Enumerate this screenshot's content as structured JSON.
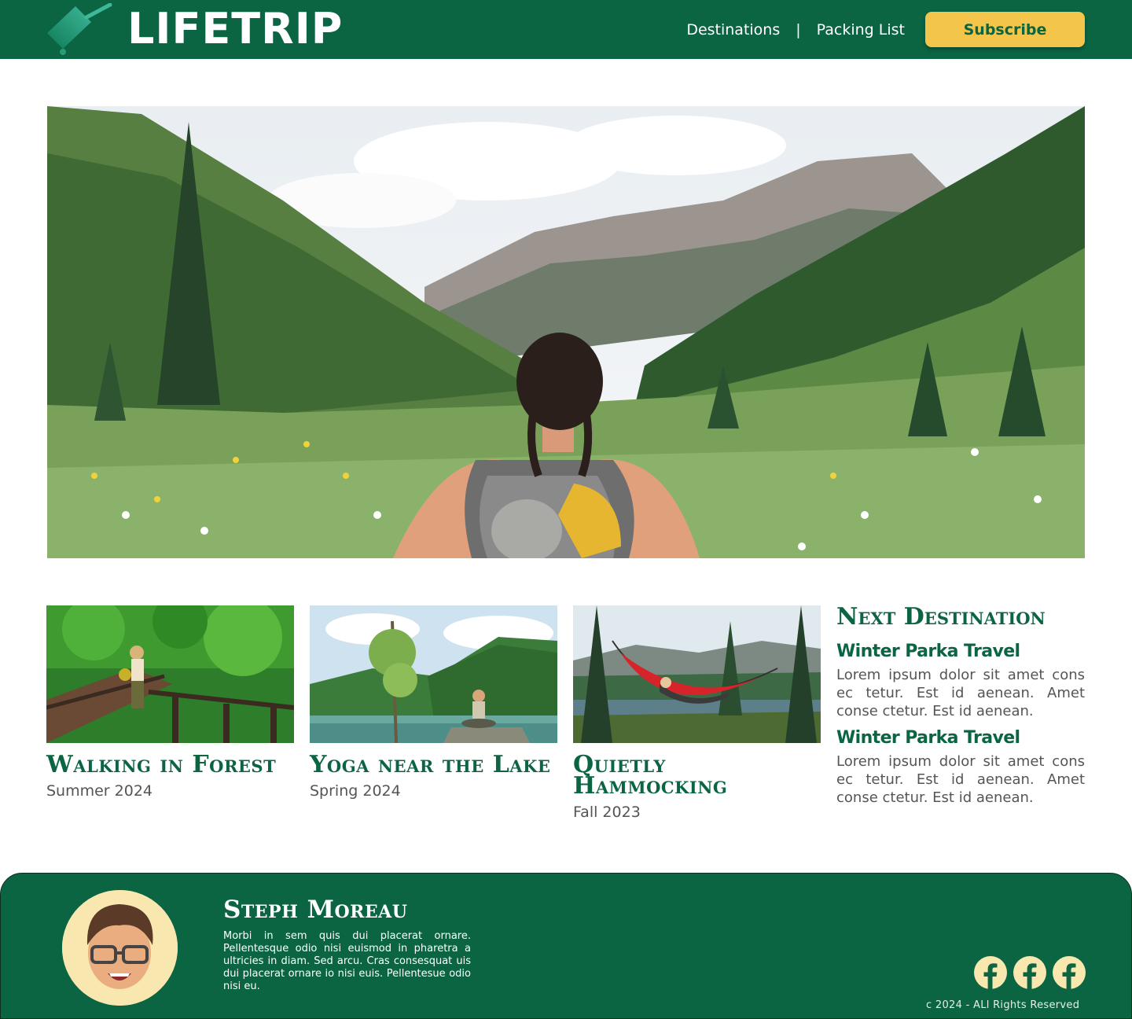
{
  "header": {
    "logo_text": "LIFETRIP",
    "logo_icon": "suitcase-icon",
    "nav": [
      {
        "label": "Destinations"
      },
      {
        "separator": "|"
      },
      {
        "label": "Packing List"
      }
    ],
    "subscribe_label": "Subscribe"
  },
  "hero": {
    "image": "hiker-in-mountain-valley"
  },
  "cards": [
    {
      "title": "Walking in Forest",
      "season": "Summer 2024",
      "image": "forest-boardwalk"
    },
    {
      "title": "Yoga near the Lake",
      "season": "Spring 2024",
      "image": "lake-yoga"
    },
    {
      "title": "Quietly Hammocking",
      "season": "Fall 2023",
      "image": "red-hammock"
    }
  ],
  "sidebar": {
    "title": "Next Destination",
    "items": [
      {
        "title": "Winter Parka Travel",
        "text": "Lorem ipsum dolor sit amet cons ec tetur. Est id aenean. Amet conse ctetur. Est id aenean."
      },
      {
        "title": "Winter Parka Travel",
        "text": "Lorem ipsum dolor sit amet cons ec tetur. Est id aenean. Amet conse ctetur. Est id aenean."
      }
    ]
  },
  "footer": {
    "avatar": "memoji-avatar",
    "name": "Steph Moreau",
    "bio": "Morbi in sem quis dui placerat ornare. Pellentesque odio nisi euismod in pharetra a ultricies in diam. Sed arcu. Cras consesquat uis dui placerat ornare io nisi euis. Pellentesue odio nisi eu.",
    "socials": [
      "facebook-icon",
      "facebook-icon",
      "facebook-icon"
    ],
    "copyright": "c 2024 - ALl Rights Reserved"
  },
  "colors": {
    "brand_green": "#0b6442",
    "accent_yellow": "#f3c64b",
    "avatar_bg": "#f8e8b0"
  }
}
